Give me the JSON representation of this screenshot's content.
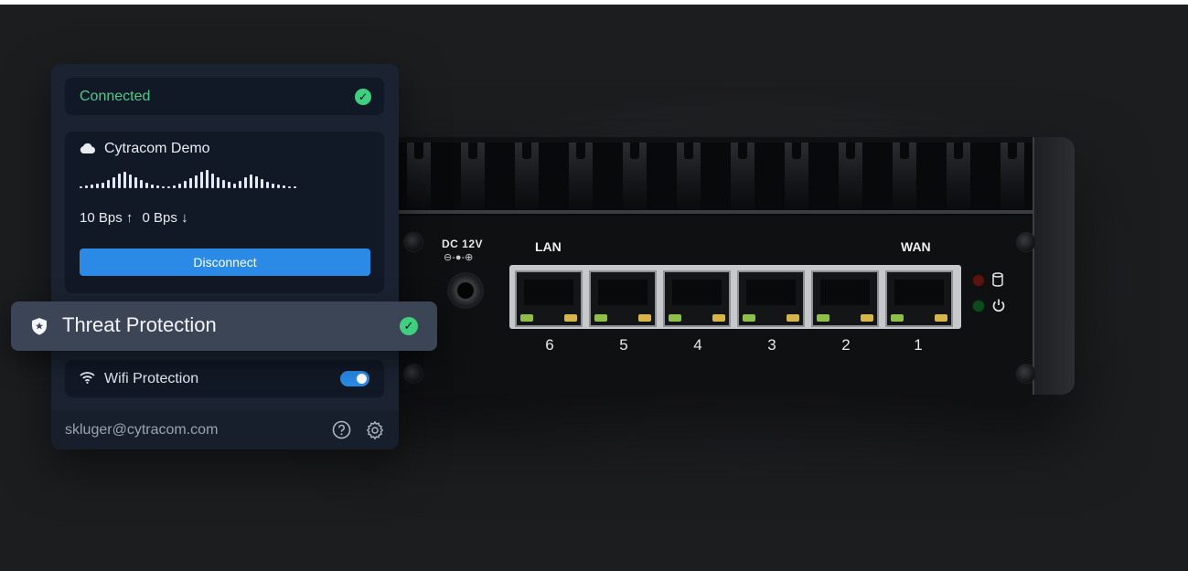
{
  "colors": {
    "accent_blue": "#2b8ae6",
    "status_green": "#3fcf7e",
    "panel_bg": "#1b2332",
    "card_bg": "#121926"
  },
  "panel": {
    "status": {
      "label": "Connected",
      "icon": "check-circle-icon"
    },
    "network": {
      "icon": "cloud-icon",
      "name": "Cytracom Demo",
      "upload_speed": "10 Bps",
      "upload_icon": "arrow-up-icon",
      "download_speed": "0 Bps",
      "download_icon": "arrow-down-icon",
      "disconnect_label": "Disconnect"
    },
    "threat_protection": {
      "icon": "shield-icon",
      "label": "Threat Protection",
      "status_icon": "check-circle-icon"
    },
    "wifi_protection": {
      "icon": "wifi-icon",
      "label": "Wifi Protection",
      "enabled": true
    },
    "footer": {
      "email": "skluger@cytracom.com",
      "help_icon": "help-circle-icon",
      "settings_icon": "gear-icon"
    }
  },
  "device": {
    "power_label": "DC 12V",
    "power_symbol": "⊖-●-⊕",
    "lan_label": "LAN",
    "wan_label": "WAN",
    "port_numbers": [
      "6",
      "5",
      "4",
      "3",
      "2",
      "1"
    ],
    "status_icons": [
      "database-icon",
      "power-icon"
    ]
  }
}
